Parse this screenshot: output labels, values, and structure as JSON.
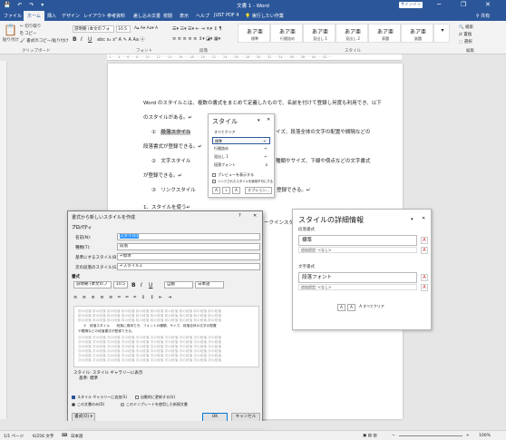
{
  "window": {
    "title": "文書 1 - Word",
    "signin": "サインイン",
    "minimize": "─",
    "restore": "❐",
    "close": "✕"
  },
  "tabs": [
    "ファイル",
    "ホーム",
    "挿入",
    "デザイン",
    "レイアウト",
    "参考資料",
    "差し込み文書",
    "校閲",
    "表示",
    "ヘルプ",
    "JUST PDF 4"
  ],
  "tell_me": "実行したい作業",
  "share": "共有",
  "ribbon": {
    "paste": "貼り付け",
    "cut": "切り取り",
    "copy": "コピー",
    "format_painter": "書式のコピー/貼り付け",
    "clipboard_group": "クリップボード",
    "font_name": "游明朝 (本文のフォ",
    "font_size": "10.5",
    "font_group": "フォント",
    "paragraph_group": "段落",
    "styles_group": "スタイル",
    "editing": [
      "検索",
      "置換",
      "選択"
    ],
    "editing_group": "編集",
    "styles": [
      {
        "sample": "あア亜",
        "name": "標準"
      },
      {
        "sample": "あア亜",
        "name": "行間詰め"
      },
      {
        "sample": "あア亜",
        "name": "見出し 1"
      },
      {
        "sample": "あア亜",
        "name": "見出し 2"
      },
      {
        "sample": "あア亜",
        "name": "表題"
      },
      {
        "sample": "あア亜",
        "name": "副題"
      },
      {
        "sample": "あア亜",
        "name": "斜体"
      },
      {
        "sample": "あア亜",
        "name": "強調斜体 2"
      },
      {
        "sample": "あア亜",
        "name": "強調"
      },
      {
        "sample": "あア亜",
        "name": "引用文"
      },
      {
        "sample": "あア亜",
        "name": "引用文 2"
      }
    ]
  },
  "document": {
    "line1": "Word のスタイルとは、複数の書式をまとめて定義したもので、名前を付けて登録し何度も利用でき、以下",
    "line2": "のスタイルがある。↵",
    "item1_num": "①",
    "item1_name": "段落スタイル",
    "item1_rest": "イズ、段落全体の文字の配置や間隔などの",
    "line4": "段落書式が登録できる。↵",
    "item2": "②　文字スタイル",
    "item2_rest": "種類やサイズ、下線や傍点などの文字書式",
    "line6": "が登録できる。↵",
    "item3": "③　リンクスタイル",
    "item3_rest": "登録できる。↵",
    "heading": "1．スタイルを使う↵",
    "dialog_edge": "ークインスタイ"
  },
  "styles_pane": {
    "title": "スタイル",
    "items": [
      "すべてクリア",
      "標準",
      "行間詰め",
      "見出し 1",
      "段落フォント"
    ],
    "marks": [
      "",
      "↵",
      "↵",
      "↵",
      "a"
    ],
    "preview_check": "プレビューを表示する",
    "linked_check": "リンクされたスタイルを使用不可にする",
    "options": "オプション..."
  },
  "details_pane": {
    "title": "スタイルの詳細情報",
    "para_label": "段落書式",
    "para_value": "標準",
    "para_sub": "追加設定: <なし>",
    "char_label": "文字書式",
    "char_value": "段落フォント",
    "char_sub": "追加設定: <なし>",
    "clear_all": "すべてクリア"
  },
  "dialog": {
    "title": "書式から新しいスタイルを作成",
    "help": "?",
    "close": "✕",
    "properties": "プロパティ",
    "name_label": "名前(N):",
    "name_value": "スタイル1",
    "type_label": "種類(T):",
    "type_value": "段落",
    "base_label": "基準にするスタイル(B):",
    "base_value": "↵標準",
    "next_label": "次の段落のスタイル(S):",
    "next_value": "↵スタイル1",
    "format_label": "書式",
    "font": "游明朝 (本文のフ",
    "size": "10.5",
    "color": "自動",
    "lang": "日本語",
    "preview_before": "前の段落 前の段落 前の段落 前の段落 前の段落 前の段落 前の段落 前の段落 前の段落 前の段落",
    "preview_main1": "①　段落スタイル　　段落に適用でき、フォントの種類、サイズ、段落全体の文字の配置",
    "preview_main2": "や間隔などの段落書式が登録できる。",
    "preview_after": "次の段落 次の段落 次の段落 次の段落 次の段落 次の段落 次の段落 次の段落 次の段落 次の段落",
    "desc1": "スタイル: スタイル ギャラリーに表示",
    "desc2": "基準: 標準",
    "gallery_check": "スタイル ギャラリーに追加(S)",
    "auto_update": "自動的に更新する(U)",
    "this_doc": "この文書のみ(D)",
    "template": "このテンプレートを使用した新規文書",
    "format_btn": "書式(O) ▾",
    "ok": "OK",
    "cancel": "キャンセル"
  },
  "status": {
    "page": "1/1 ページ",
    "words": "6/256 文字",
    "lang": "日本語",
    "zoom": "100%"
  }
}
